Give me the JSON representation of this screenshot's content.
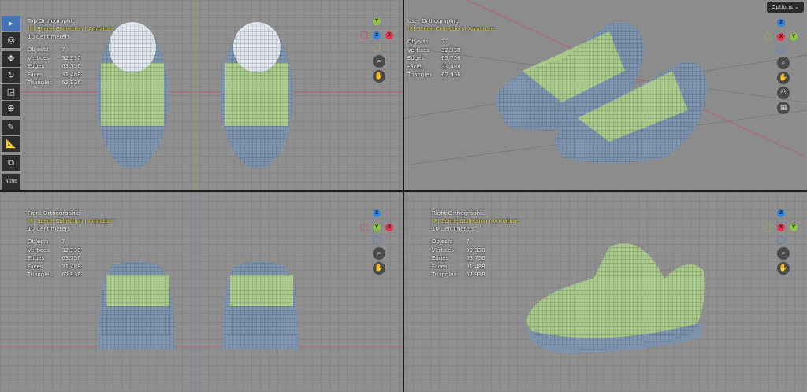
{
  "header": {
    "options_label": "Options",
    "options_chevron": "⌄"
  },
  "toolbar": [
    {
      "name": "select-box-tool",
      "glyph": "▸"
    },
    {
      "name": "cursor-tool",
      "glyph": "◎"
    },
    {
      "name": "move-tool",
      "glyph": "✥"
    },
    {
      "name": "rotate-tool",
      "glyph": "↻"
    },
    {
      "name": "scale-tool",
      "glyph": "◲"
    },
    {
      "name": "transform-tool",
      "glyph": "⊕"
    },
    {
      "name": "annotate-tool",
      "glyph": "✎"
    },
    {
      "name": "measure-tool",
      "glyph": "📐"
    },
    {
      "name": "add-cube-tool",
      "glyph": "⧉"
    },
    {
      "name": "none-tool",
      "glyph": "NONE"
    }
  ],
  "stats_labels": {
    "objects": "Objects",
    "vertices": "Vertices",
    "edges": "Edges",
    "faces": "Faces",
    "triangles": "Triangles"
  },
  "stats": {
    "objects": "7",
    "vertices": "32,330",
    "edges": "63,756",
    "faces": "31,488",
    "triangles": "62,936"
  },
  "collection": "(8) Scene Collection | Armature",
  "viewports": [
    {
      "title": "Top Orthographic",
      "scale": "10 Centimeters",
      "gizmo": {
        "top": "Y",
        "right": "X",
        "center": "Z"
      }
    },
    {
      "title": "User Orthographic",
      "scale": "",
      "gizmo": {
        "top": "Z",
        "right": "Y",
        "center": "X"
      }
    },
    {
      "title": "Front Orthographic",
      "scale": "10 Centimeters",
      "gizmo": {
        "top": "Z",
        "right": "X",
        "center": "Y"
      }
    },
    {
      "title": "Right Orthographic",
      "scale": "10 Centimeters",
      "gizmo": {
        "top": "Z",
        "right": "Y",
        "center": "X"
      }
    }
  ],
  "colors": {
    "x": "#e8344f",
    "y": "#8cc63f",
    "z": "#2f83e2",
    "mesh_blue": "#7d93ad",
    "mesh_green": "#a9c98a",
    "accent": "#4772b3"
  }
}
